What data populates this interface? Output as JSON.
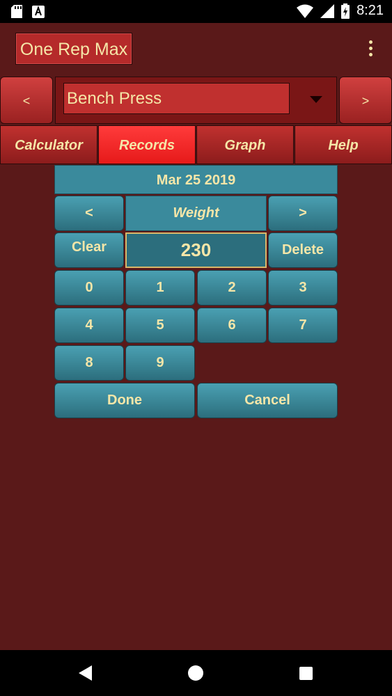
{
  "status_bar": {
    "time": "8:21"
  },
  "app": {
    "title": "One Rep Max"
  },
  "exercise": {
    "prev_label": "<",
    "name": "Bench Press",
    "next_label": ">"
  },
  "tabs": [
    {
      "label": "Calculator",
      "active": false
    },
    {
      "label": "Records",
      "active": true
    },
    {
      "label": "Graph",
      "active": false
    },
    {
      "label": "Help",
      "active": false
    }
  ],
  "keypad": {
    "date": "Mar 25 2019",
    "prev_label": "<",
    "field_label": "Weight",
    "next_label": ">",
    "clear_label": "Clear",
    "value": "230",
    "delete_label": "Delete",
    "digits": [
      "0",
      "1",
      "2",
      "3",
      "4",
      "5",
      "6",
      "7",
      "8",
      "9"
    ],
    "done_label": "Done",
    "cancel_label": "Cancel"
  },
  "colors": {
    "background": "#5a1919",
    "accent": "#3a8a9c",
    "text": "#f5e6a8",
    "active_tab": "#ff3b3b"
  }
}
